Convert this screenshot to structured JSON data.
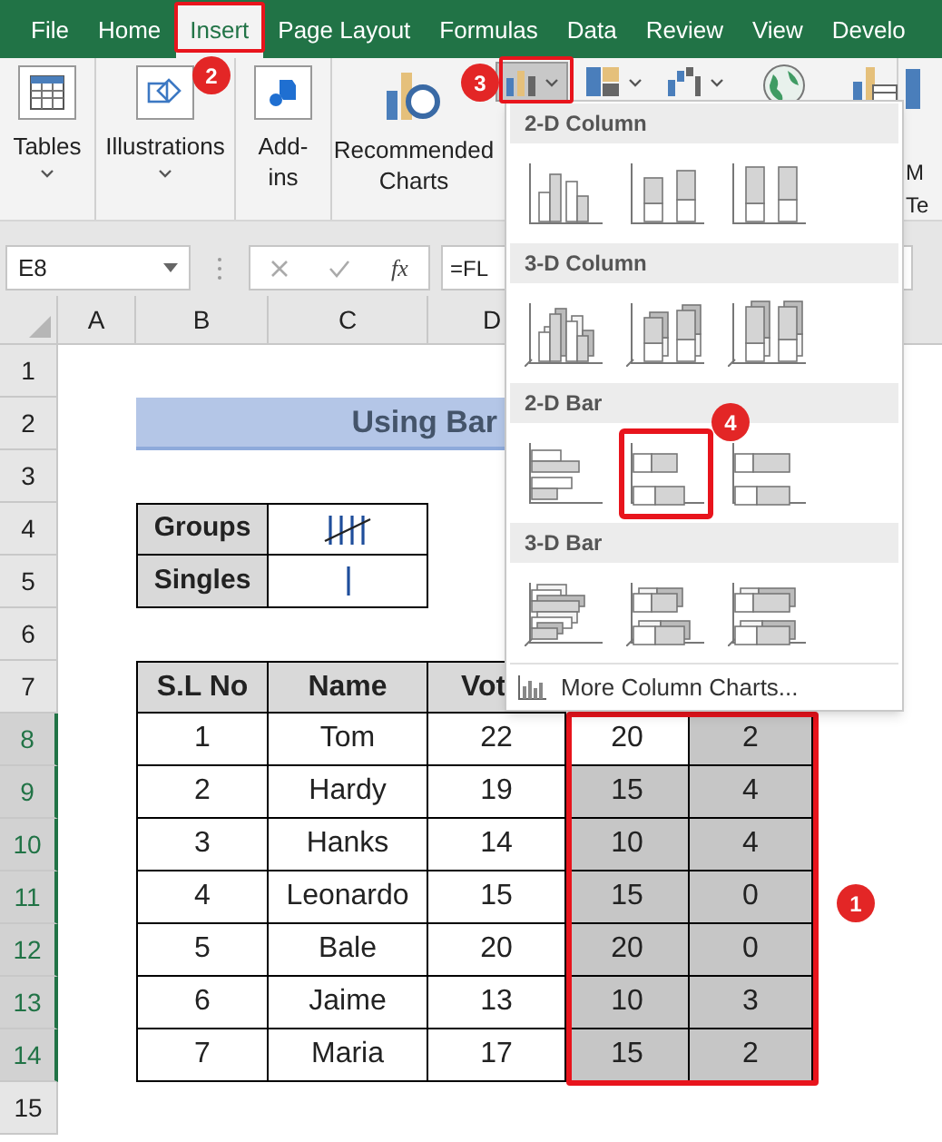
{
  "tabs": [
    {
      "label": "File",
      "selected": false
    },
    {
      "label": "Home",
      "selected": false
    },
    {
      "label": "Insert",
      "selected": true
    },
    {
      "label": "Page Layout",
      "selected": false
    },
    {
      "label": "Formulas",
      "selected": false
    },
    {
      "label": "Data",
      "selected": false
    },
    {
      "label": "Review",
      "selected": false
    },
    {
      "label": "View",
      "selected": false
    },
    {
      "label": "Develo",
      "selected": false
    }
  ],
  "ribbon": {
    "groups": [
      {
        "kind": "tables",
        "lines": [
          "Tables"
        ]
      },
      {
        "kind": "illustrations",
        "lines": [
          "Illustrations"
        ]
      },
      {
        "kind": "addins",
        "lines": [
          "Add-",
          "ins"
        ]
      },
      {
        "kind": "recommended",
        "lines": [
          "Recommended",
          "Charts"
        ]
      }
    ],
    "chart_buttons": [
      {
        "kind": "column",
        "selected": true
      },
      {
        "kind": "hierarchy",
        "selected": false
      },
      {
        "kind": "waterfall",
        "selected": false
      },
      {
        "kind": "map",
        "selected": false
      },
      {
        "kind": "pivot",
        "selected": false
      }
    ],
    "edge_lines": [
      "M",
      "Te"
    ]
  },
  "formula_bar": {
    "name_box": "E8",
    "function_label": "fx",
    "formula": "=FL"
  },
  "sheet": {
    "columns": [
      "A",
      "B",
      "C",
      "D"
    ],
    "rows": [
      {
        "label": "1",
        "selected": false
      },
      {
        "label": "2",
        "selected": false
      },
      {
        "label": "3",
        "selected": false
      },
      {
        "label": "4",
        "selected": false
      },
      {
        "label": "5",
        "selected": false
      },
      {
        "label": "6",
        "selected": false
      },
      {
        "label": "7",
        "selected": false
      },
      {
        "label": "8",
        "selected": true
      },
      {
        "label": "9",
        "selected": true
      },
      {
        "label": "10",
        "selected": true
      },
      {
        "label": "11",
        "selected": true
      },
      {
        "label": "12",
        "selected": true
      },
      {
        "label": "13",
        "selected": true
      },
      {
        "label": "14",
        "selected": true
      },
      {
        "label": "15",
        "selected": false
      }
    ],
    "title": "Using Bar",
    "tally_rows": [
      {
        "label": "Groups",
        "kind": "group"
      },
      {
        "label": "Singles",
        "kind": "single"
      }
    ],
    "table": {
      "columns": [
        "S.L No",
        "Name",
        "Vot"
      ],
      "rows": [
        {
          "cells": [
            "1",
            "Tom",
            "22"
          ],
          "extra": [
            {
              "text": "20",
              "highlighted": false
            },
            {
              "text": "2",
              "highlighted": true
            }
          ]
        },
        {
          "cells": [
            "2",
            "Hardy",
            "19"
          ],
          "extra": [
            {
              "text": "15",
              "highlighted": true
            },
            {
              "text": "4",
              "highlighted": true
            }
          ]
        },
        {
          "cells": [
            "3",
            "Hanks",
            "14"
          ],
          "extra": [
            {
              "text": "10",
              "highlighted": true
            },
            {
              "text": "4",
              "highlighted": true
            }
          ]
        },
        {
          "cells": [
            "4",
            "Leonardo",
            "15"
          ],
          "extra": [
            {
              "text": "15",
              "highlighted": true
            },
            {
              "text": "0",
              "highlighted": true
            }
          ]
        },
        {
          "cells": [
            "5",
            "Bale",
            "20"
          ],
          "extra": [
            {
              "text": "20",
              "highlighted": true
            },
            {
              "text": "0",
              "highlighted": true
            }
          ]
        },
        {
          "cells": [
            "6",
            "Jaime",
            "13"
          ],
          "extra": [
            {
              "text": "10",
              "highlighted": true
            },
            {
              "text": "3",
              "highlighted": true
            }
          ]
        },
        {
          "cells": [
            "7",
            "Maria",
            "17"
          ],
          "extra": [
            {
              "text": "15",
              "highlighted": true
            },
            {
              "text": "2",
              "highlighted": true
            }
          ]
        }
      ]
    }
  },
  "chart_menu": {
    "sections": [
      {
        "title": "2-D Column",
        "kind": "column2d",
        "items": [
          {
            "kind": "clustered",
            "selected": false
          },
          {
            "kind": "stacked",
            "selected": false
          },
          {
            "kind": "percent",
            "selected": false
          }
        ]
      },
      {
        "title": "3-D Column",
        "kind": "column3d",
        "items": [
          {
            "kind": "clustered",
            "selected": false
          },
          {
            "kind": "stacked",
            "selected": false
          },
          {
            "kind": "percent",
            "selected": false
          }
        ]
      },
      {
        "title": "2-D Bar",
        "kind": "bar2d",
        "items": [
          {
            "kind": "clustered",
            "selected": false
          },
          {
            "kind": "stacked",
            "selected": true
          },
          {
            "kind": "percent",
            "selected": false
          }
        ]
      },
      {
        "title": "3-D Bar",
        "kind": "bar3d",
        "items": [
          {
            "kind": "clustered",
            "selected": false
          },
          {
            "kind": "stacked",
            "selected": false
          },
          {
            "kind": "percent",
            "selected": false
          }
        ]
      }
    ],
    "footer": "More Column Charts..."
  },
  "callouts": [
    {
      "label": "1"
    },
    {
      "label": "2"
    },
    {
      "label": "3"
    },
    {
      "label": "4"
    }
  ]
}
